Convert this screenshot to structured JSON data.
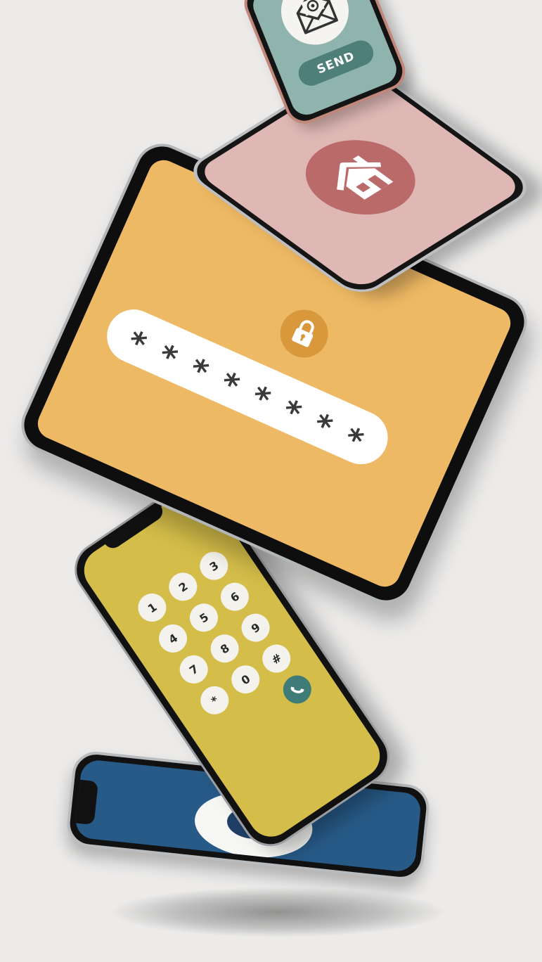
{
  "colors": {
    "background": "#ecebea",
    "send_screen": "#8fb4ae",
    "home_screen": "#dfb8b5",
    "home_accent": "#bb6a6a",
    "tablet_screen": "#eeb964",
    "lock_accent": "#d9983b",
    "keypad_screen": "#d4bd49",
    "call_button": "#3f7c78",
    "map_screen": "#275a87"
  },
  "icons": {
    "mail": "envelope-at-icon",
    "home": "house-icon",
    "lock": "padlock-icon",
    "call": "phone-handset-icon",
    "location": "map-pin-icon"
  },
  "send_phone": {
    "send_label": "SEND"
  },
  "tablet": {
    "password_mask": [
      "*",
      "*",
      "*",
      "*",
      "*",
      "*",
      "*",
      "*"
    ]
  },
  "keypad": {
    "keys": [
      "1",
      "2",
      "3",
      "4",
      "5",
      "6",
      "7",
      "8",
      "9",
      "*",
      "0",
      "#"
    ]
  }
}
